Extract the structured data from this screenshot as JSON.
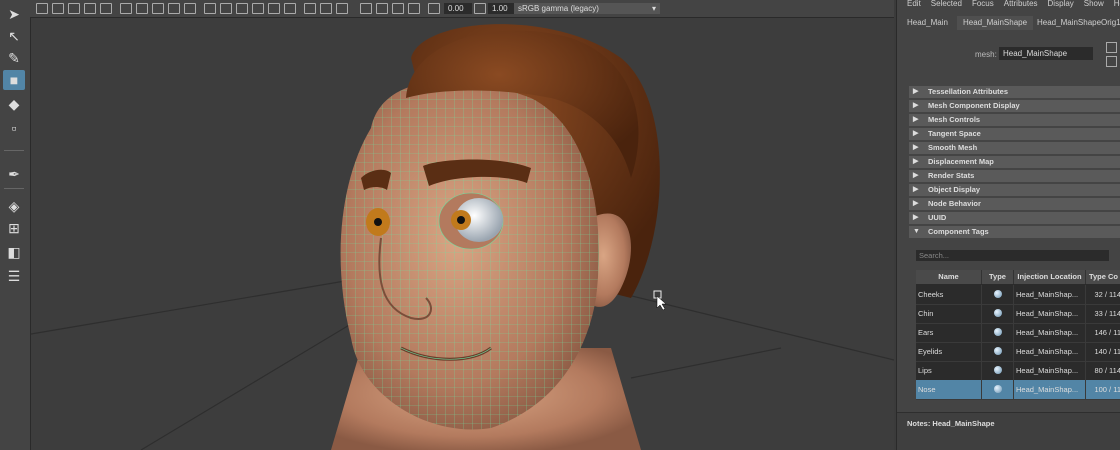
{
  "toolbox": {
    "tools": [
      {
        "name": "select-tool",
        "icon": "arrow-cursor-icon",
        "glyph": "➤"
      },
      {
        "name": "lasso-tool",
        "icon": "lasso-icon",
        "glyph": "↖"
      },
      {
        "name": "paint-select-tool",
        "icon": "brush-icon",
        "glyph": "✎"
      },
      {
        "name": "move-tool",
        "icon": "move-icon",
        "glyph": "■",
        "active": true
      },
      {
        "name": "rotate-tool",
        "icon": "rotate-icon",
        "glyph": "◆"
      },
      {
        "name": "scale-tool",
        "icon": "scale-icon",
        "glyph": "▫"
      },
      {
        "name": "soft-mod-tool",
        "icon": "soft-mod-icon",
        "glyph": "✒"
      },
      {
        "name": "single-view-layout",
        "icon": "single-view-icon",
        "glyph": "◈"
      },
      {
        "name": "four-view-layout",
        "icon": "four-view-icon",
        "glyph": "⊞"
      },
      {
        "name": "two-view-layout",
        "icon": "two-view-icon",
        "glyph": "◧"
      },
      {
        "name": "outliner-layout",
        "icon": "outliner-icon",
        "glyph": "☰"
      }
    ]
  },
  "statusbar": {
    "exposure_value": "0.00",
    "gamma_value": "1.00",
    "color_space": "sRGB gamma (legacy)"
  },
  "panel": {
    "menu": [
      "Edit",
      "Selected",
      "Focus",
      "Attributes",
      "Display",
      "Show",
      "Help"
    ],
    "tabs": [
      "Head_Main",
      "Head_MainShape",
      "Head_MainShapeOrig1"
    ],
    "active_tab": 1,
    "mesh_label": "mesh:",
    "mesh_value": "Head_MainShape",
    "sections": [
      "Tessellation Attributes",
      "Mesh Component Display",
      "Mesh Controls",
      "Tangent Space",
      "Smooth Mesh",
      "Displacement Map",
      "Render Stats",
      "Object Display",
      "Node Behavior",
      "UUID",
      "Component Tags"
    ],
    "expanded_section": 10,
    "search_placeholder": "Search...",
    "table": {
      "headers": [
        "Name",
        "Type",
        "Injection Location",
        "Type Co"
      ],
      "rows": [
        {
          "name": "Cheeks",
          "location": "Head_MainShap...",
          "count": "32 / 114"
        },
        {
          "name": "Chin",
          "location": "Head_MainShap...",
          "count": "33 / 114"
        },
        {
          "name": "Ears",
          "location": "Head_MainShap...",
          "count": "146 / 11"
        },
        {
          "name": "Eyelids",
          "location": "Head_MainShap...",
          "count": "140 / 11"
        },
        {
          "name": "Lips",
          "location": "Head_MainShap...",
          "count": "80 / 114"
        },
        {
          "name": "Nose",
          "location": "Head_MainShap...",
          "count": "100 / 11",
          "selected": true
        }
      ]
    },
    "notes_label": "Notes:  Head_MainShape"
  }
}
